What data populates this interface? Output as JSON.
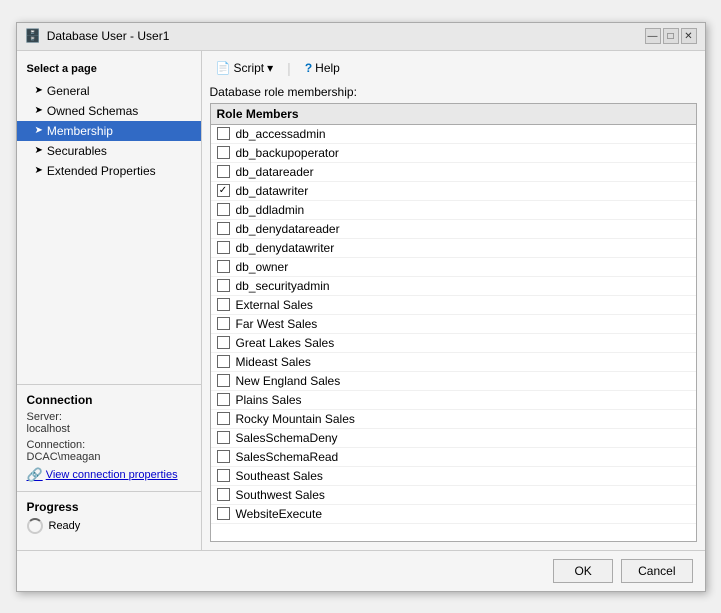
{
  "window": {
    "title": "Database User - User1",
    "title_icon": "🗄️"
  },
  "title_controls": {
    "minimize": "—",
    "maximize": "□",
    "close": "✕"
  },
  "left_panel": {
    "section_label": "Select a page",
    "nav_items": [
      {
        "id": "general",
        "label": "General",
        "active": false
      },
      {
        "id": "owned-schemas",
        "label": "Owned Schemas",
        "active": false
      },
      {
        "id": "membership",
        "label": "Membership",
        "active": true
      },
      {
        "id": "securables",
        "label": "Securables",
        "active": false
      },
      {
        "id": "extended-properties",
        "label": "Extended Properties",
        "active": false
      }
    ],
    "connection": {
      "title": "Connection",
      "server_label": "Server:",
      "server_value": "localhost",
      "connection_label": "Connection:",
      "connection_value": "DCAC\\meagan",
      "link_text": "View connection properties"
    },
    "progress": {
      "title": "Progress",
      "status": "Ready"
    }
  },
  "toolbar": {
    "script_label": "Script",
    "help_label": "Help"
  },
  "content": {
    "section_label": "Database role membership:",
    "list_header": "Role Members",
    "roles": [
      {
        "id": "db_accessadmin",
        "label": "db_accessadmin",
        "checked": false
      },
      {
        "id": "db_backupoperator",
        "label": "db_backupoperator",
        "checked": false
      },
      {
        "id": "db_datareader",
        "label": "db_datareader",
        "checked": false
      },
      {
        "id": "db_datawriter",
        "label": "db_datawriter",
        "checked": true
      },
      {
        "id": "db_ddladmin",
        "label": "db_ddladmin",
        "checked": false
      },
      {
        "id": "db_denydatareader",
        "label": "db_denydatareader",
        "checked": false
      },
      {
        "id": "db_denydatawriter",
        "label": "db_denydatawriter",
        "checked": false
      },
      {
        "id": "db_owner",
        "label": "db_owner",
        "checked": false
      },
      {
        "id": "db_securityadmin",
        "label": "db_securityadmin",
        "checked": false
      },
      {
        "id": "external-sales",
        "label": "External Sales",
        "checked": false
      },
      {
        "id": "far-west-sales",
        "label": "Far West Sales",
        "checked": false
      },
      {
        "id": "great-lakes-sales",
        "label": "Great Lakes Sales",
        "checked": false
      },
      {
        "id": "mideast-sales",
        "label": "Mideast Sales",
        "checked": false
      },
      {
        "id": "new-england-sales",
        "label": "New England Sales",
        "checked": false
      },
      {
        "id": "plains-sales",
        "label": "Plains Sales",
        "checked": false
      },
      {
        "id": "rocky-mountain-sales",
        "label": "Rocky Mountain Sales",
        "checked": false
      },
      {
        "id": "salesschema-deny",
        "label": "SalesSchemaDeny",
        "checked": false
      },
      {
        "id": "salesschema-read",
        "label": "SalesSchemaRead",
        "checked": false
      },
      {
        "id": "southeast-sales",
        "label": "Southeast Sales",
        "checked": false
      },
      {
        "id": "southwest-sales",
        "label": "Southwest Sales",
        "checked": false
      },
      {
        "id": "website-execute",
        "label": "WebsiteExecute",
        "checked": false
      }
    ]
  },
  "buttons": {
    "ok": "OK",
    "cancel": "Cancel"
  }
}
